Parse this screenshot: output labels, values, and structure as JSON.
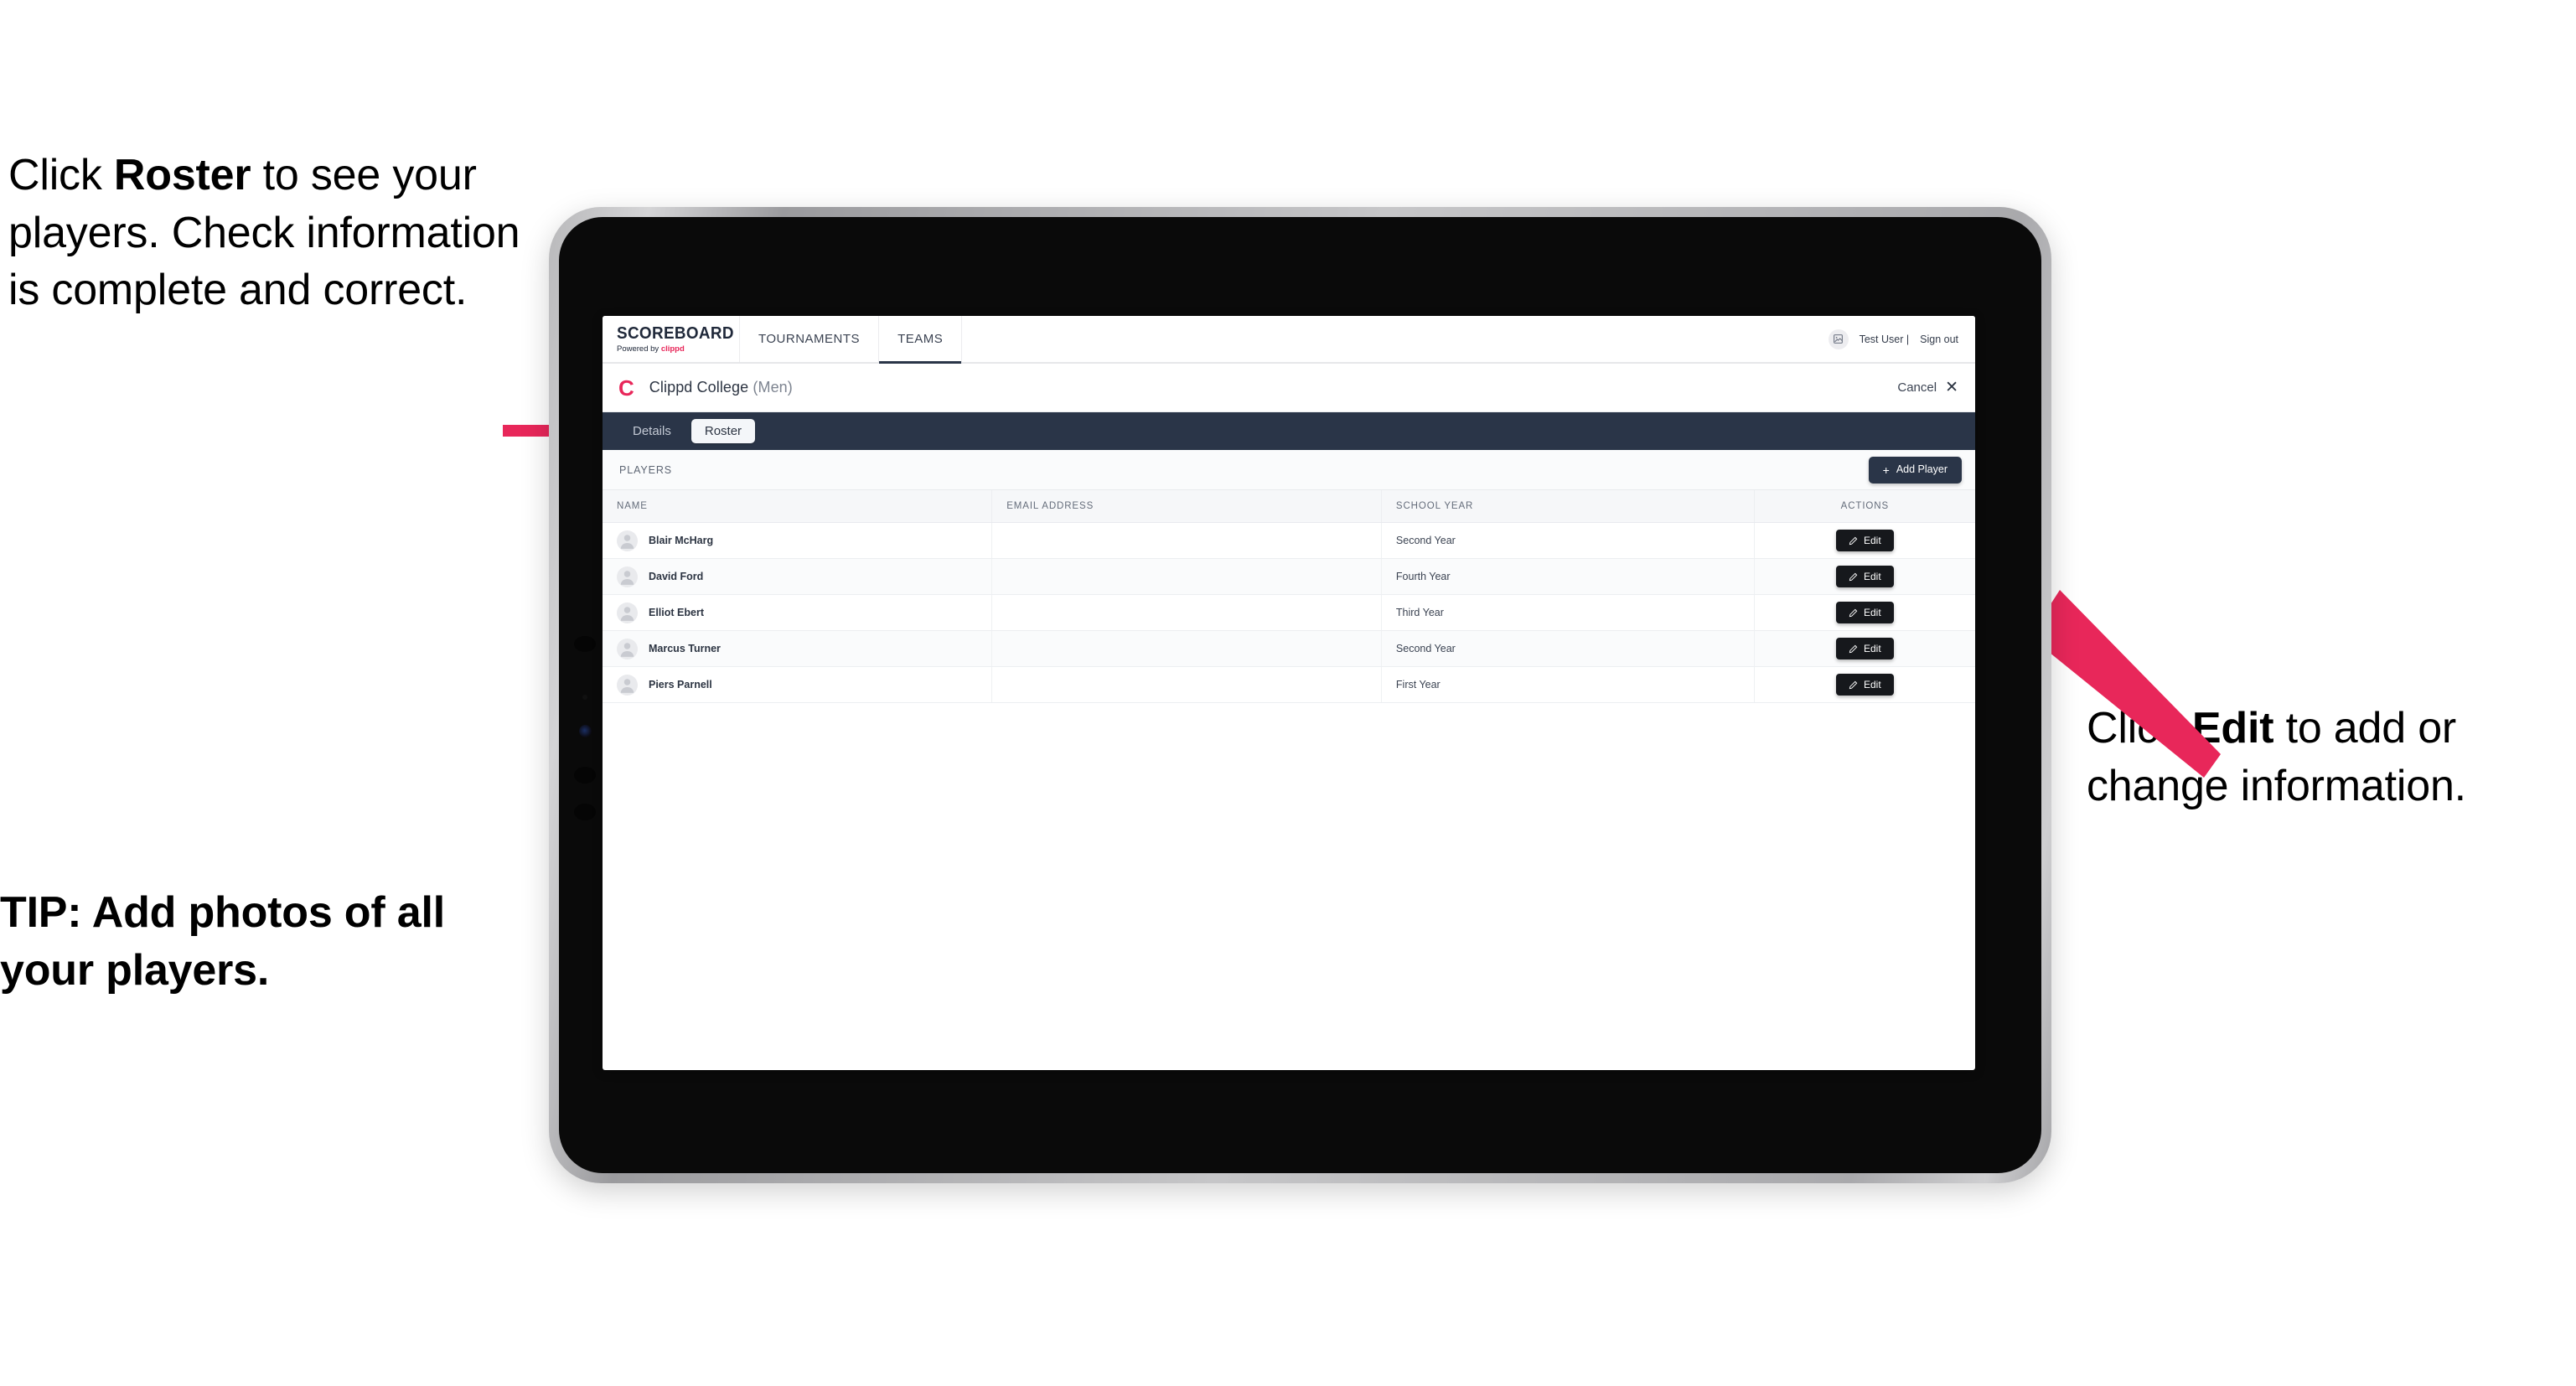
{
  "annotations": {
    "left_top": {
      "pre": "Click ",
      "bold": "Roster",
      "post": " to see your players. Check information is complete and correct."
    },
    "left_tip": "TIP: Add photos of all your players.",
    "right": {
      "pre": "Click ",
      "bold": "Edit",
      "post": " to add or change information."
    }
  },
  "colors": {
    "accent_pink": "#e8275a",
    "navy": "#2a3548",
    "dark_button": "#16181c"
  },
  "app": {
    "brand": {
      "title": "SCOREBOARD",
      "powered_prefix": "Powered by ",
      "powered_brand": "clippd"
    },
    "nav_tabs": [
      {
        "label": "TOURNAMENTS",
        "active": false
      },
      {
        "label": "TEAMS",
        "active": true
      }
    ],
    "user": {
      "name": "Test User |",
      "sign_out": "Sign out",
      "avatar_icon": "user-image-icon"
    },
    "team_header": {
      "logo_letter": "C",
      "name": "Clippd College",
      "gender": "(Men)",
      "cancel_label": "Cancel",
      "cancel_icon": "close-icon"
    },
    "sub_tabs": [
      {
        "label": "Details",
        "active": false
      },
      {
        "label": "Roster",
        "active": true
      }
    ],
    "players_toolbar": {
      "section_label": "PLAYERS",
      "add_player_label": "Add Player",
      "add_player_plus": "+"
    },
    "table": {
      "columns": [
        "NAME",
        "EMAIL ADDRESS",
        "SCHOOL YEAR",
        "ACTIONS"
      ],
      "rows": [
        {
          "name": "Blair McHarg",
          "email": "",
          "school_year": "Second Year",
          "action_label": "Edit"
        },
        {
          "name": "David Ford",
          "email": "",
          "school_year": "Fourth Year",
          "action_label": "Edit"
        },
        {
          "name": "Elliot Ebert",
          "email": "",
          "school_year": "Third Year",
          "action_label": "Edit"
        },
        {
          "name": "Marcus Turner",
          "email": "",
          "school_year": "Second Year",
          "action_label": "Edit"
        },
        {
          "name": "Piers Parnell",
          "email": "",
          "school_year": "First Year",
          "action_label": "Edit"
        }
      ]
    }
  }
}
